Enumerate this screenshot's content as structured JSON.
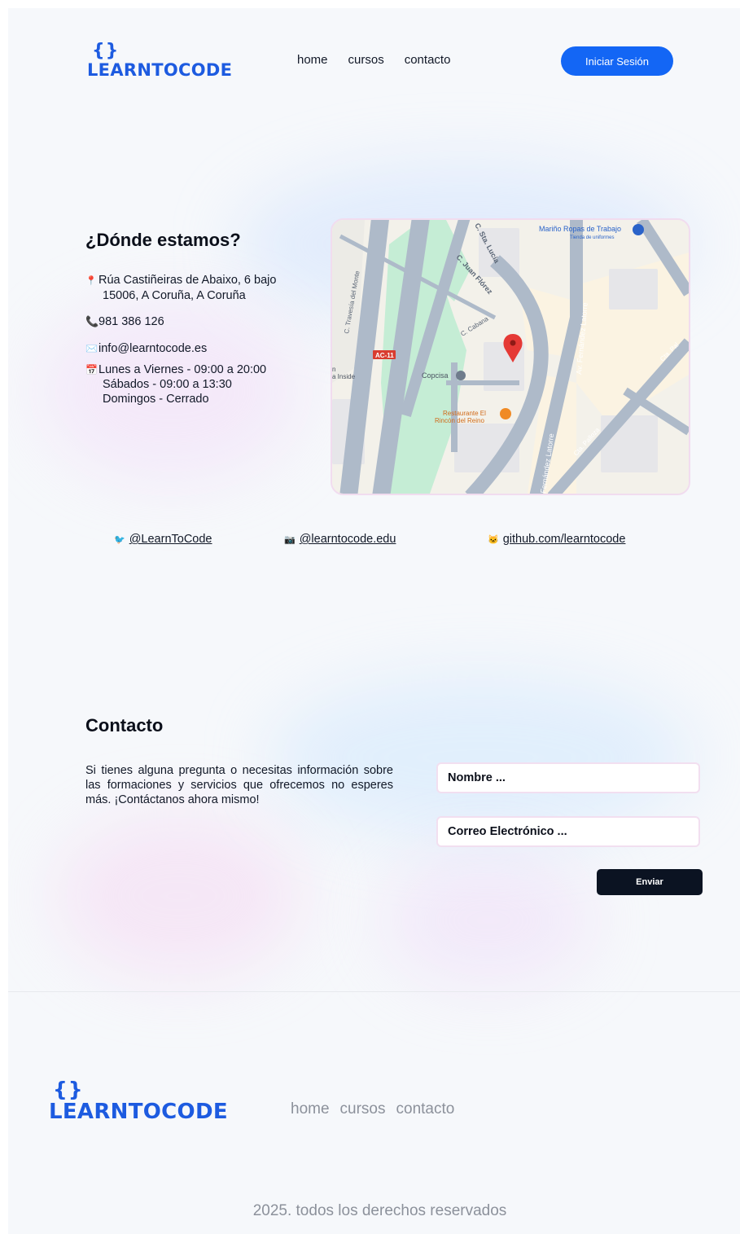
{
  "header": {
    "logo_braces": "{}",
    "logo_word": "LEARNTOCODE",
    "nav": [
      "home",
      "cursos",
      "contacto"
    ],
    "login_label": "Iniciar Sesión"
  },
  "location": {
    "title": "¿Dónde estamos?",
    "address_line1": "Rúa Castiñeiras de Abaixo, 6 bajo",
    "address_line2": "15006, A Coruña, A Coruña",
    "phone": "981 386 126",
    "email": "info@learntocode.es",
    "hours_line1": "Lunes a Viernes - 09:00 a 20:00",
    "hours_line2": "Sábados - 09:00 a 13:30",
    "hours_line3": "Domingos - Cerrado",
    "icons": {
      "address": "📍",
      "phone": "📞",
      "email": "✉️",
      "hours": "📅"
    }
  },
  "map": {
    "labels": {
      "shop_name": "Mariño Ropas de Trabajo",
      "shop_sub": "Tienda de uniformes",
      "sta_lucia": "C. Sta. Lucía",
      "juan_florez": "C. Juan Flórez",
      "travesia": "C. Travesía del Monte",
      "cabana": "C. Cabana",
      "fernandez_latorre": "Av. Fernández Latorre",
      "fernandez_latorre_2": "Fernández Latorre",
      "cta_palloza": "Cta. Palloza",
      "cta_pal": "Cta. Pal",
      "copcisa": "Copcisa",
      "restaurant_1": "Restaurante El",
      "restaurant_2": "Rincón del Reino",
      "ac11": "AC-11",
      "inside_1": "n",
      "inside_2": "a Inside"
    },
    "colors": {
      "road": "#aebac9",
      "park": "#c5edd5",
      "block": "#fbf3e2",
      "building": "#e6e6e9",
      "pin": "#e53935"
    }
  },
  "socials": [
    {
      "icon": "🐦",
      "label": "@LearnToCode"
    },
    {
      "icon": "📷",
      "label": "@learntocode.edu"
    },
    {
      "icon": "🐱",
      "label": "github.com/learntocode"
    }
  ],
  "contact": {
    "title": "Contacto",
    "text": "Si tienes alguna pregunta o necesitas información sobre las formaciones y servicios que ofrecemos no esperes más. ¡Contáctanos ahora mismo!",
    "name_placeholder": "Nombre ...",
    "email_placeholder": "Correo Electrónico ...",
    "send_label": "Enviar"
  },
  "footer": {
    "logo_braces": "{}",
    "logo_word": "LEARNTOCODE",
    "nav": [
      "home",
      "cursos",
      "contacto"
    ],
    "copyright": "2025. todos los derechos reservados"
  },
  "colors": {
    "brand": "#1d5be0",
    "login_button": "#1366f5",
    "send_button": "#0b1322",
    "background": "#f6f8fb",
    "muted_text": "#8c919b"
  }
}
